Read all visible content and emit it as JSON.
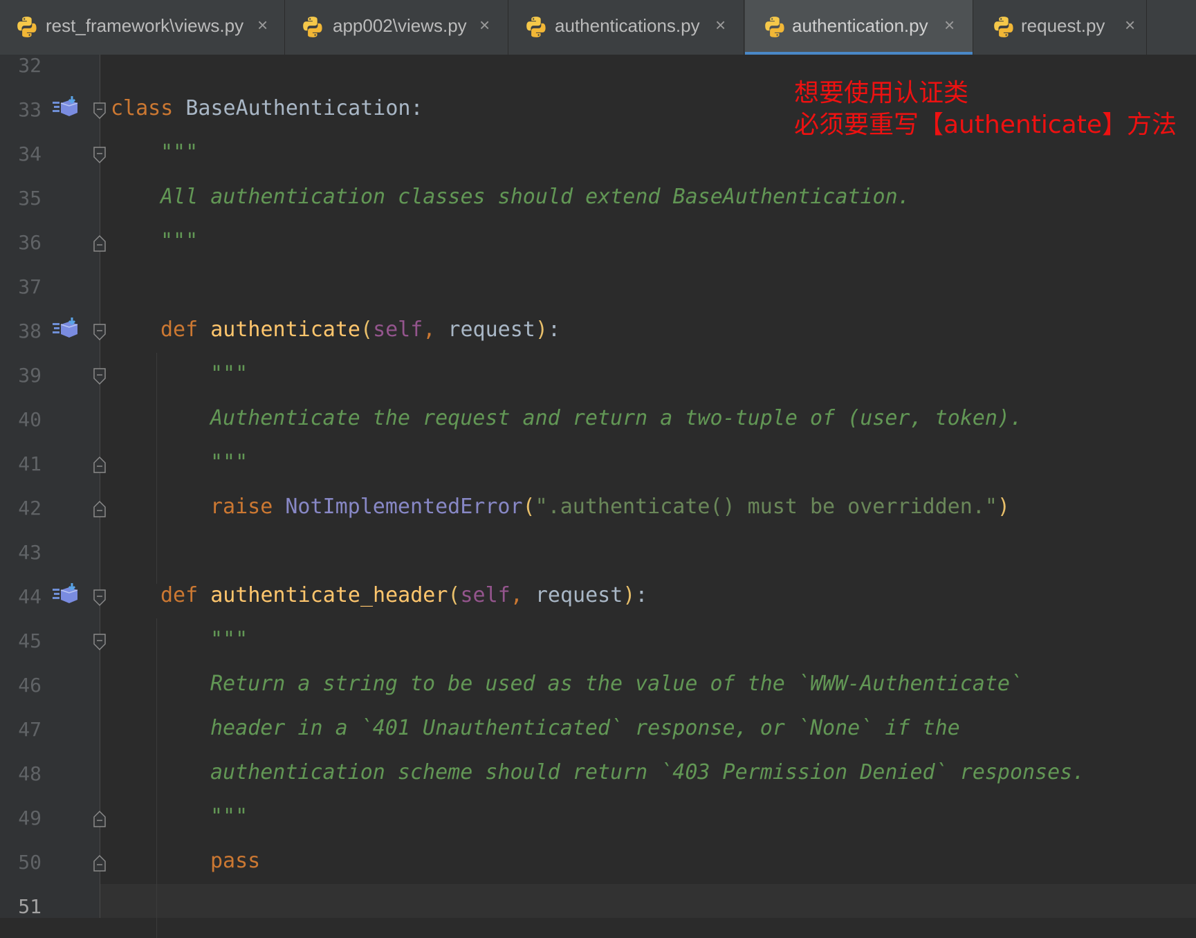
{
  "tabs": [
    {
      "label": "rest_framework\\views.py",
      "icon": "python-file-icon",
      "active": false
    },
    {
      "label": "app002\\views.py",
      "icon": "python-file-icon",
      "active": false
    },
    {
      "label": "authentications.py",
      "icon": "python-file-icon",
      "active": false
    },
    {
      "label": "authentication.py",
      "icon": "python-file-icon",
      "active": true
    },
    {
      "label": "request.py",
      "icon": "python-file-icon",
      "active": false
    }
  ],
  "tab_close_glyph": "×",
  "line_numbers": [
    "32",
    "33",
    "34",
    "35",
    "36",
    "37",
    "38",
    "39",
    "40",
    "41",
    "42",
    "43",
    "44",
    "45",
    "46",
    "47",
    "48",
    "49",
    "50",
    "51"
  ],
  "code": {
    "l33": {
      "kw": "class",
      "rest": " BaseAuthentication:"
    },
    "l34": "\"\"\"",
    "l35": "All authentication classes should extend BaseAuthentication.",
    "l36": "\"\"\"",
    "l38": {
      "kw": "def",
      "name": "authenticate",
      "open": "(",
      "self": "self",
      "comma": ",",
      "arg": " request",
      "close": ")",
      "colon": ":"
    },
    "l39": "\"\"\"",
    "l40": "Authenticate the request and return a two-tuple of (user, token).",
    "l41": "\"\"\"",
    "l42": {
      "kw": "raise",
      "cls": "NotImplementedError",
      "open": "(",
      "str": "\".authenticate() must be overridden.\"",
      "close": ")"
    },
    "l44": {
      "kw": "def",
      "name": "authenticate_header",
      "open": "(",
      "self": "self",
      "comma": ",",
      "arg": " request",
      "close": ")",
      "colon": ":"
    },
    "l45": "\"\"\"",
    "l46": "Return a string to be used as the value of the `WWW-Authenticate`",
    "l47": "header in a `401 Unauthenticated` response, or `None` if the",
    "l48": "authentication scheme should return `403 Permission Denied` responses.",
    "l49": "\"\"\"",
    "l50": "pass"
  },
  "annotation": {
    "line1": "想要使用认证类",
    "line2": "必须要重写【authenticate】方法",
    "color": "#ee1111"
  },
  "colors": {
    "keyword": "#cc7832",
    "function": "#ffc66d",
    "self": "#94558d",
    "builtin_class": "#8888c6",
    "string": "#6a8759",
    "docstring": "#629755",
    "active_tab_underline": "#4a88c7"
  }
}
